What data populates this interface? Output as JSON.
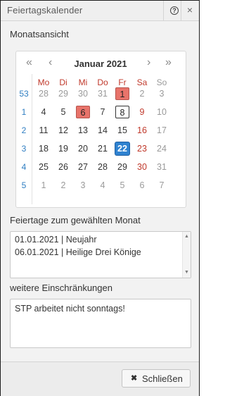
{
  "window": {
    "title": "Feiertagskalender",
    "help_glyph": "?",
    "close_glyph": "×",
    "help_icon": "help-circle-icon",
    "close_icon": "close-icon"
  },
  "month_view": {
    "label": "Monatsansicht"
  },
  "calendar": {
    "month_title": "Januar 2021",
    "nav": {
      "prev_year": "«",
      "prev_month": "‹",
      "next_month": "›",
      "next_year": "»"
    },
    "weekdays": [
      "Mo",
      "Di",
      "Mi",
      "Do",
      "Fr",
      "Sa",
      "So"
    ],
    "week_numbers": [
      "53",
      "1",
      "2",
      "3",
      "4",
      "5"
    ],
    "weeks": [
      [
        {
          "d": "28",
          "s": "gray"
        },
        {
          "d": "29",
          "s": "gray"
        },
        {
          "d": "30",
          "s": "gray"
        },
        {
          "d": "31",
          "s": "gray"
        },
        {
          "d": "1",
          "s": "holiday"
        },
        {
          "d": "2",
          "s": "gray"
        },
        {
          "d": "3",
          "s": "gray"
        }
      ],
      [
        {
          "d": "4",
          "s": "normal"
        },
        {
          "d": "5",
          "s": "normal"
        },
        {
          "d": "6",
          "s": "holiday"
        },
        {
          "d": "7",
          "s": "normal"
        },
        {
          "d": "8",
          "s": "today"
        },
        {
          "d": "9",
          "s": "saturday"
        },
        {
          "d": "10",
          "s": "gray"
        }
      ],
      [
        {
          "d": "11",
          "s": "normal"
        },
        {
          "d": "12",
          "s": "normal"
        },
        {
          "d": "13",
          "s": "normal"
        },
        {
          "d": "14",
          "s": "normal"
        },
        {
          "d": "15",
          "s": "normal"
        },
        {
          "d": "16",
          "s": "saturday"
        },
        {
          "d": "17",
          "s": "gray"
        }
      ],
      [
        {
          "d": "18",
          "s": "normal"
        },
        {
          "d": "19",
          "s": "normal"
        },
        {
          "d": "20",
          "s": "normal"
        },
        {
          "d": "21",
          "s": "normal"
        },
        {
          "d": "22",
          "s": "selected"
        },
        {
          "d": "23",
          "s": "saturday"
        },
        {
          "d": "24",
          "s": "gray"
        }
      ],
      [
        {
          "d": "25",
          "s": "normal"
        },
        {
          "d": "26",
          "s": "normal"
        },
        {
          "d": "27",
          "s": "normal"
        },
        {
          "d": "28",
          "s": "normal"
        },
        {
          "d": "29",
          "s": "normal"
        },
        {
          "d": "30",
          "s": "saturday"
        },
        {
          "d": "31",
          "s": "gray"
        }
      ],
      [
        {
          "d": "1",
          "s": "gray"
        },
        {
          "d": "2",
          "s": "gray"
        },
        {
          "d": "3",
          "s": "gray"
        },
        {
          "d": "4",
          "s": "gray"
        },
        {
          "d": "5",
          "s": "gray"
        },
        {
          "d": "6",
          "s": "gray"
        },
        {
          "d": "7",
          "s": "gray"
        }
      ]
    ],
    "colors": {
      "holiday_bg": "#e8736a",
      "selected_bg": "#2f82d0",
      "today_border": "#333333",
      "weekend_red": "#c0392b",
      "week_number_blue": "#2f7ec2"
    }
  },
  "holidays": {
    "label": "Feiertage zum gewählten Monat",
    "lines": [
      "01.01.2021 | Neujahr",
      "06.01.2021 | Heilige Drei Könige"
    ]
  },
  "restrictions": {
    "label": "weitere Einschränkungen",
    "text": "STP arbeitet nicht sonntags!"
  },
  "footer": {
    "close_button_label": "Schließen",
    "close_button_icon": "close-icon"
  }
}
